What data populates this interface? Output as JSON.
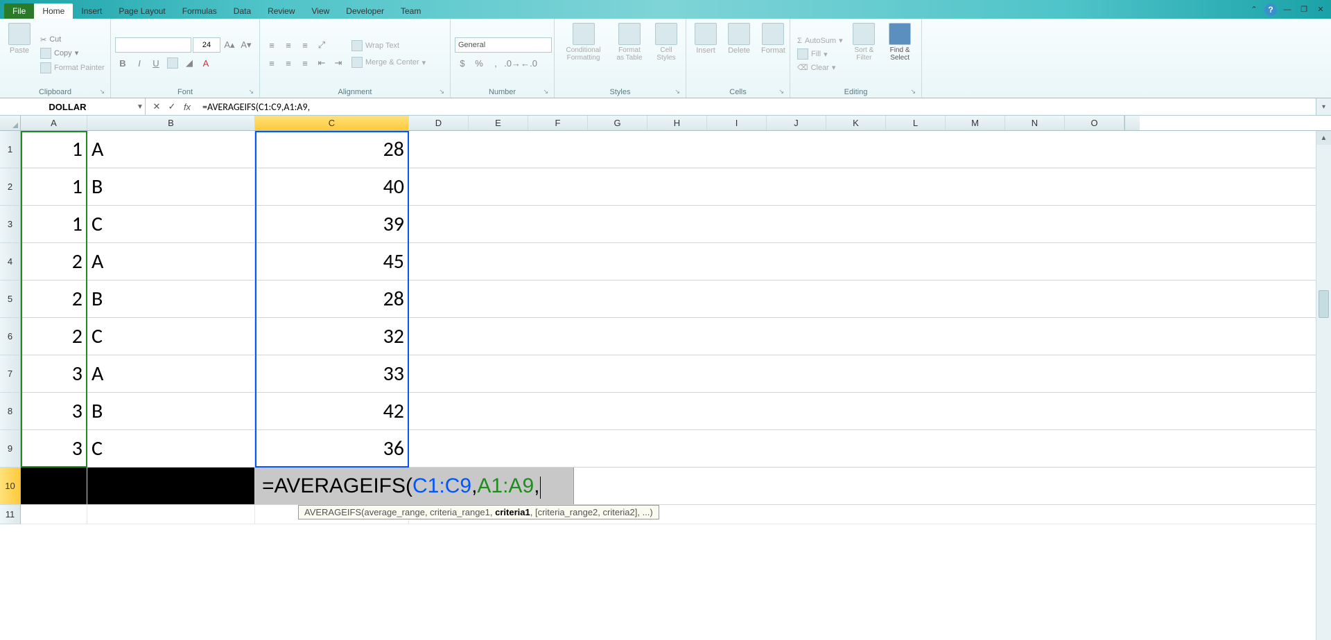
{
  "tabs": {
    "file": "File",
    "home": "Home",
    "insert": "Insert",
    "pagelayout": "Page Layout",
    "formulas": "Formulas",
    "data": "Data",
    "review": "Review",
    "view": "View",
    "developer": "Developer",
    "team": "Team"
  },
  "ribbon": {
    "clipboard": {
      "label": "Clipboard",
      "paste": "Paste",
      "cut": "Cut",
      "copy": "Copy",
      "painter": "Format Painter"
    },
    "font": {
      "label": "Font",
      "size": "24",
      "bold": "B",
      "italic": "I",
      "underline": "U"
    },
    "alignment": {
      "label": "Alignment",
      "wrap": "Wrap Text",
      "merge": "Merge & Center"
    },
    "number": {
      "label": "Number",
      "format": "General"
    },
    "styles": {
      "label": "Styles",
      "cond": "Conditional Formatting",
      "table": "Format as Table",
      "cellstyles": "Cell Styles"
    },
    "cells": {
      "label": "Cells",
      "insert": "Insert",
      "delete": "Delete",
      "format": "Format"
    },
    "editing": {
      "label": "Editing",
      "autosum": "AutoSum",
      "fill": "Fill",
      "clear": "Clear",
      "sort": "Sort & Filter",
      "find": "Find & Select"
    }
  },
  "namebox": "DOLLAR",
  "formulabar": "=AVERAGEIFS(C1:C9,A1:A9,",
  "columns": [
    "A",
    "B",
    "C",
    "D",
    "E",
    "F",
    "G",
    "H",
    "I",
    "J",
    "K",
    "L",
    "M",
    "N",
    "O"
  ],
  "rows": [
    "1",
    "2",
    "3",
    "4",
    "5",
    "6",
    "7",
    "8",
    "9",
    "10",
    "11"
  ],
  "data": {
    "A": [
      "1",
      "1",
      "1",
      "2",
      "2",
      "2",
      "3",
      "3",
      "3"
    ],
    "B": [
      "A",
      "B",
      "C",
      "A",
      "B",
      "C",
      "A",
      "B",
      "C"
    ],
    "C": [
      "28",
      "40",
      "39",
      "45",
      "28",
      "32",
      "33",
      "42",
      "36"
    ]
  },
  "editing_cell": {
    "prefix": "=AVERAGEIFS(",
    "range1": "C1:C9",
    "sep1": ",",
    "range2": "A1:A9",
    "suffix": ","
  },
  "tooltip": {
    "fn": "AVERAGEIFS",
    "p1": "average_range",
    "p2": "criteria_range1",
    "p3": "criteria1",
    "p4": "[criteria_range2, criteria2], ...",
    "close": ")"
  },
  "chart_data": {
    "type": "table",
    "columns": [
      "A",
      "B",
      "C"
    ],
    "rows": [
      [
        1,
        "A",
        28
      ],
      [
        1,
        "B",
        40
      ],
      [
        1,
        "C",
        39
      ],
      [
        2,
        "A",
        45
      ],
      [
        2,
        "B",
        28
      ],
      [
        2,
        "C",
        32
      ],
      [
        3,
        "A",
        33
      ],
      [
        3,
        "B",
        42
      ],
      [
        3,
        "C",
        36
      ]
    ]
  }
}
